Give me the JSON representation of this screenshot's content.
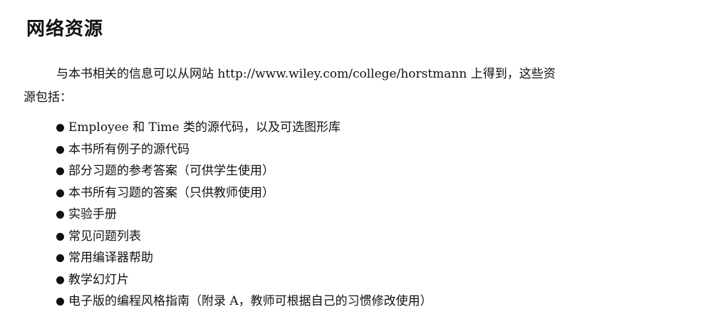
{
  "section": {
    "heading": "网络资源",
    "intro_line1": "与本书相关的信息可以从网站 http://www.wiley.com/college/horstmann 上得到，这些资",
    "intro_line2": "源包括：",
    "items": [
      "Employee 和 Time 类的源代码，以及可选图形库",
      "本书所有例子的源代码",
      "部分习题的参考答案（可供学生使用）",
      "本书所有习题的答案（只供教师使用）",
      "实验手册",
      "常见问题列表",
      "常用编译器帮助",
      "教学幻灯片",
      "电子版的编程风格指南（附录 A，教师可根据自己的习惯修改使用）"
    ]
  }
}
